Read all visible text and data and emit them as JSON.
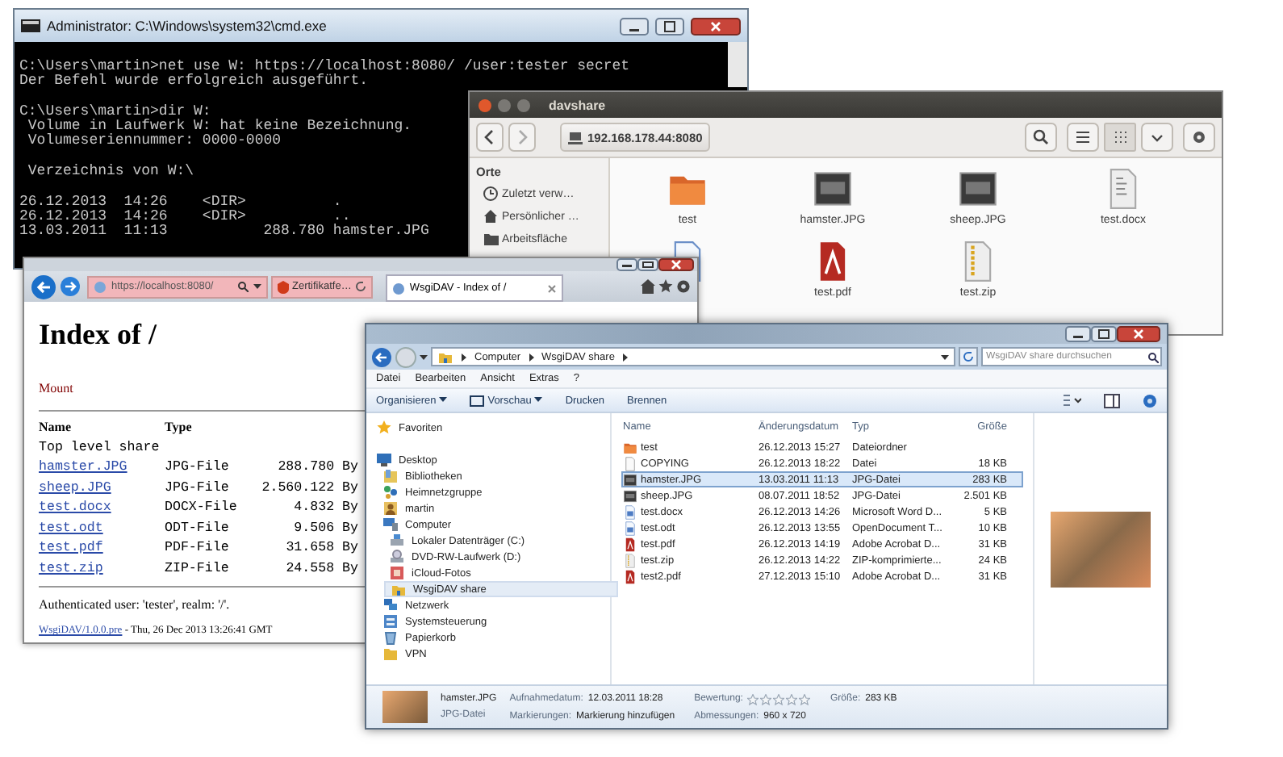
{
  "cmd": {
    "title": "Administrator: C:\\Windows\\system32\\cmd.exe",
    "blocks": [
      [
        "C:\\Users\\martin>net use W: https://localhost:8080/ /user:tester secret",
        "Der Befehl wurde erfolgreich ausgeführt."
      ],
      [
        "C:\\Users\\martin>dir W:",
        " Volume in Laufwerk W: hat keine Bezeichnung.",
        " Volumeseriennummer: 0000-0000"
      ],
      [
        " Verzeichnis von W:\\"
      ],
      [
        "26.12.2013  14:26    <DIR>          .",
        "26.12.2013  14:26    <DIR>          ..",
        "13.03.2011  11:13           288.780 hamster.JPG"
      ]
    ]
  },
  "nautilus": {
    "title": "davshare",
    "location": "192.168.178.44:8080",
    "sidebar": {
      "heading": "Orte",
      "items": [
        {
          "label": "Zuletzt verw…",
          "kind": "recent"
        },
        {
          "label": "Persönlicher …",
          "kind": "home"
        },
        {
          "label": "Arbeitsfläche",
          "kind": "desktop"
        }
      ]
    },
    "files": [
      {
        "name": "test",
        "kind": "folder"
      },
      {
        "name": "hamster.JPG",
        "kind": "image"
      },
      {
        "name": "sheep.JPG",
        "kind": "image"
      },
      {
        "name": "test.docx",
        "kind": "text"
      },
      {
        "kind": "document"
      },
      {
        "name": "test.pdf",
        "kind": "pdf"
      },
      {
        "name": "test.zip",
        "kind": "archive"
      }
    ]
  },
  "browser": {
    "address": "https://localhost:8080/",
    "certificate": "Zertifikatfe…",
    "tab": "WsgiDAV - Index of /",
    "heading": "Index of /",
    "mount_link": "Mount",
    "columns": [
      "Name",
      "Type"
    ],
    "rows": [
      {
        "kind": "description",
        "name": "Top level share"
      },
      {
        "kind": "file",
        "name": "hamster.JPG",
        "type": "JPG-File",
        "size": "288.780 By"
      },
      {
        "kind": "file",
        "name": "sheep.JPG",
        "type": "JPG-File",
        "size": "2.560.122 By"
      },
      {
        "kind": "file",
        "name": "test.docx",
        "type": "DOCX-File",
        "size": "4.832 By"
      },
      {
        "kind": "file",
        "name": "test.odt",
        "type": "ODT-File",
        "size": "9.506 By"
      },
      {
        "kind": "file",
        "name": "test.pdf",
        "type": "PDF-File",
        "size": "31.658 By"
      },
      {
        "kind": "file",
        "name": "test.zip",
        "type": "ZIP-File",
        "size": "24.558 By"
      }
    ],
    "auth": "Authenticated user: 'tester', realm: '/'.",
    "footer_link": "WsgiDAV/1.0.0.pre",
    "footer_text": " - Thu, 26 Dec 2013 13:26:41 GMT"
  },
  "explorer": {
    "breadcrumb": [
      "Computer",
      "WsgiDAV share"
    ],
    "search_placeholder": "WsgiDAV share durchsuchen",
    "menu": [
      "Datei",
      "Bearbeiten",
      "Ansicht",
      "Extras",
      "?"
    ],
    "toolbar": [
      {
        "label": "Organisieren",
        "kind": "menu"
      },
      {
        "label": "Vorschau",
        "kind": "preview"
      },
      {
        "label": "Drucken",
        "kind": "plain"
      },
      {
        "label": "Brennen",
        "kind": "plain"
      }
    ],
    "nav": [
      {
        "label": "Favoriten",
        "kind": "star",
        "selected": false
      },
      {
        "label": "Desktop",
        "kind": "desktop",
        "selected": false,
        "children": [
          {
            "label": "Bibliotheken",
            "kind": "library",
            "selected": false
          },
          {
            "label": "Heimnetzgruppe",
            "kind": "homegroup",
            "selected": false
          },
          {
            "label": "martin",
            "kind": "user",
            "selected": false
          },
          {
            "label": "Computer",
            "kind": "computer",
            "selected": false,
            "children": [
              {
                "label": "Lokaler Datenträger (C:)",
                "kind": "drive",
                "selected": false
              },
              {
                "label": "DVD-RW-Laufwerk (D:)",
                "kind": "disc",
                "selected": false
              },
              {
                "label": "iCloud-Fotos",
                "kind": "photos",
                "selected": false
              },
              {
                "label": "WsgiDAV share",
                "kind": "share",
                "selected": true
              }
            ]
          },
          {
            "label": "Netzwerk",
            "kind": "network",
            "selected": false
          },
          {
            "label": "Systemsteuerung",
            "kind": "control",
            "selected": false
          },
          {
            "label": "Papierkorb",
            "kind": "trash",
            "selected": false
          },
          {
            "label": "VPN",
            "kind": "folder",
            "selected": false
          }
        ]
      }
    ],
    "columns": [
      "Name",
      "Änderungsdatum",
      "Typ",
      "Größe"
    ],
    "rows": [
      {
        "name": "test",
        "kind": "folder",
        "date": "26.12.2013 15:27",
        "type": "Dateiordner",
        "selected": false
      },
      {
        "name": "COPYING",
        "kind": "file",
        "date": "26.12.2013 18:22",
        "type": "Datei",
        "size": "18 KB",
        "selected": false
      },
      {
        "name": "hamster.JPG",
        "kind": "image",
        "date": "13.03.2011 11:13",
        "type": "JPG-Datei",
        "size": "283 KB",
        "selected": true
      },
      {
        "name": "sheep.JPG",
        "kind": "image",
        "date": "08.07.2011 18:52",
        "type": "JPG-Datei",
        "size": "2.501 KB",
        "selected": false
      },
      {
        "name": "test.docx",
        "kind": "document",
        "date": "26.12.2013 14:26",
        "type": "Microsoft Word D...",
        "size": "5 KB",
        "selected": false
      },
      {
        "name": "test.odt",
        "kind": "document",
        "date": "26.12.2013 13:55",
        "type": "OpenDocument T...",
        "size": "10 KB",
        "selected": false
      },
      {
        "name": "test.pdf",
        "kind": "pdf",
        "date": "26.12.2013 14:19",
        "type": "Adobe Acrobat D...",
        "size": "31 KB",
        "selected": false
      },
      {
        "name": "test.zip",
        "kind": "archive",
        "date": "26.12.2013 14:22",
        "type": "ZIP-komprimierte...",
        "size": "24 KB",
        "selected": false
      },
      {
        "name": "test2.pdf",
        "kind": "pdf",
        "date": "27.12.2013 15:10",
        "type": "Adobe Acrobat D...",
        "size": "31 KB",
        "selected": false
      }
    ],
    "details": {
      "name": "hamster.JPG",
      "type": "JPG-Datei",
      "fields": [
        {
          "label": "Aufnahmedatum:",
          "value": "12.03.2011 18:28"
        },
        {
          "label": "Markierungen:",
          "value": "Markierung hinzufügen"
        },
        {
          "label": "Bewertung:",
          "stars": 0
        },
        {
          "label": "Abmessungen:",
          "value": "960 x 720"
        },
        {
          "label": "Größe:",
          "value": "283 KB"
        }
      ]
    }
  }
}
